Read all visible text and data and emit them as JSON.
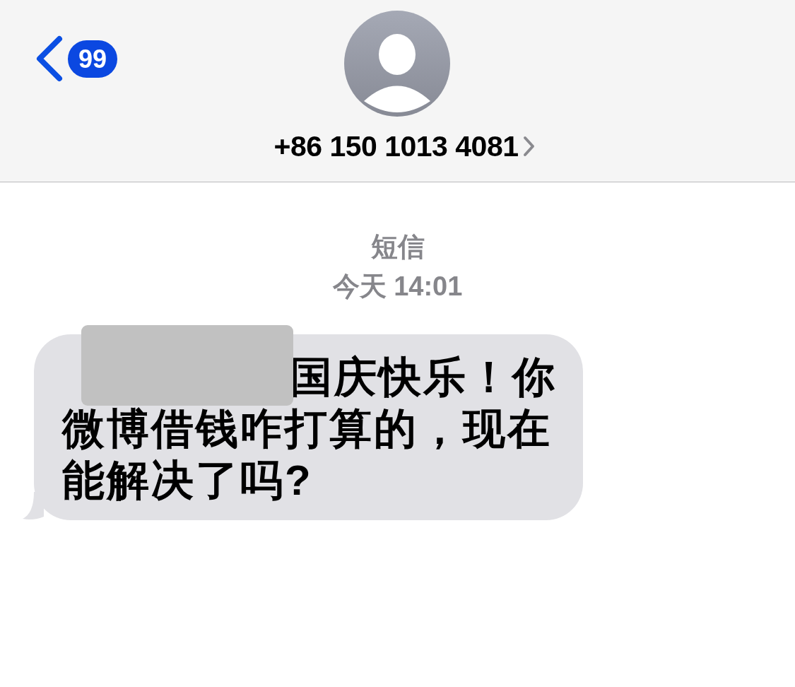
{
  "header": {
    "back_badge": "99",
    "contact": "+86 150 1013 4081"
  },
  "conversation": {
    "service": "短信",
    "time": "今天 14:01"
  },
  "message": {
    "text": "国庆快乐！你微博借钱咋打算的，现在能解决了吗?",
    "redacted": true
  }
}
